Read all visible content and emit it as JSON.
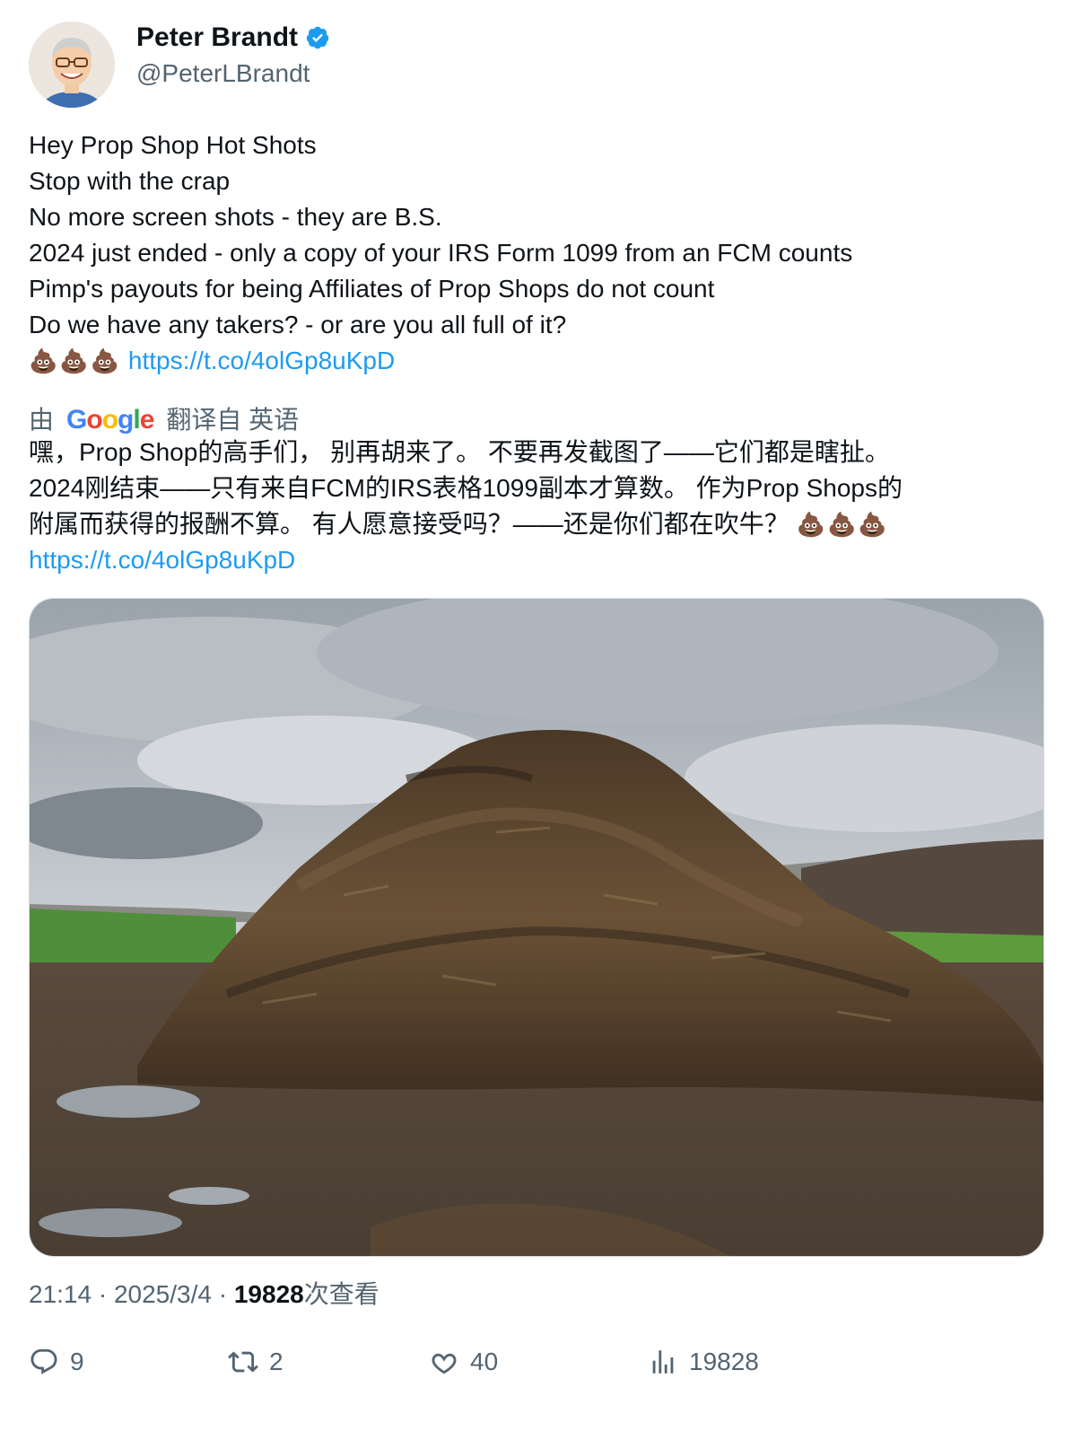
{
  "author": {
    "name": "Peter Brandt",
    "handle": "@PeterLBrandt",
    "verified_icon": "verified-badge-icon"
  },
  "tweet": {
    "lines": [
      "Hey Prop Shop Hot Shots",
      "Stop with the crap",
      "No more screen shots - they are B.S.",
      "2024 just ended - only a copy of your IRS Form 1099 from an FCM counts",
      "Pimp's payouts for being Affiliates of Prop Shops do not count",
      "Do we have any takers? - or are you all full of it?"
    ],
    "emoji": "💩💩💩",
    "link": "https://t.co/4olGp8uKpD"
  },
  "translation": {
    "prefix": "由",
    "provider": "Google",
    "suffix": "翻译自 英语",
    "lines": [
      "嘿，Prop Shop的高手们， 别再胡来了。 不要再发截图了——它们都是瞎扯。",
      "2024刚结束——只有来自FCM的IRS表格1099副本才算数。 作为Prop Shops的",
      "附属而获得的报酬不算。 有人愿意接受吗？——还是你们都在吹牛？"
    ],
    "emoji": "💩💩💩",
    "link": "https://t.co/4olGp8uKpD"
  },
  "meta": {
    "time": "21:14",
    "date": "2025/3/4",
    "views": "19828",
    "views_suffix": "次查看"
  },
  "actions": {
    "replies": "9",
    "retweets": "2",
    "likes": "40",
    "views": "19828"
  },
  "colors": {
    "link": "#1d9bf0",
    "secondary": "#536471",
    "verified": "#1d9bf0"
  }
}
